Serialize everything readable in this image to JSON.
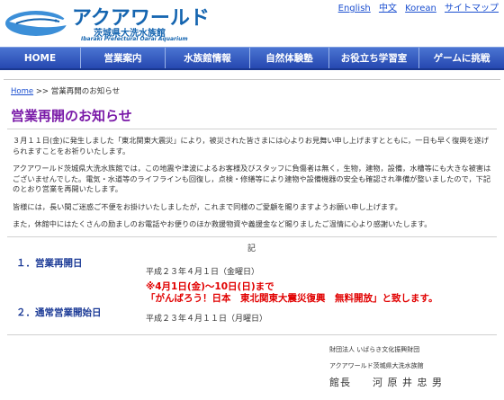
{
  "header": {
    "logo_main": "アクアワールド",
    "logo_sub": "茨城県大洗水族館",
    "logo_en": "Ibaraki Prefectural Oarai Aquarium",
    "links": [
      "English",
      "中文",
      "Korean",
      "サイトマップ"
    ]
  },
  "nav": {
    "items": [
      "HOME",
      "営業案内",
      "水族館情報",
      "自然体験塾",
      "お役立ち学習室",
      "ゲームに挑戦"
    ]
  },
  "breadcrumb": {
    "home": "Home",
    "separator": ">>",
    "current": "営業再開のお知らせ"
  },
  "page": {
    "title": "営業再開のお知らせ",
    "paragraphs": [
      "３月１１日(金)に発生しました「東北関東大震災」により，被災された皆さまには心よりお見舞い申し上げますとともに，一日も早く復興を遂げられますことをお祈りいたします。",
      "アクアワールド茨城県大洗水族館では，この地震や津波によるお客様及びスタッフに負傷者は無く，生物，建物，設備，水槽等にも大きな被害はございませんでした。電気・水道等のライフラインも回復し，点検・修繕等により建物や設備機器の安全も確認され準備が整いましたので，下記のとおり営業を再開いたします。",
      "皆様には，長い間ご迷惑ご不便をお掛けいたしましたが，これまで同様のご愛顧を賜りますようお願い申し上げます。",
      "また，休館中にはたくさんの励ましのお電話やお便りのほか救援物資や義援金など賜りましたご温情に心より感謝いたします。"
    ],
    "ki": "記",
    "items": [
      {
        "label": "１．営業再開日",
        "value": "平成２３年４月１日（金曜日）"
      },
      {
        "label": "２．通常営業開始日",
        "value": "平成２３年４月１１日（月曜日）"
      }
    ],
    "red_note": [
      "※4月1日(金)～10日(日)まで",
      "「がんばろう！日本　東北関東大震災復興　無料開放」と致します。"
    ],
    "signature": {
      "org1": "財団法人 いばらき文化振興財団",
      "org2": "アクアワールド茨城県大洗水族館",
      "name": "館長　　河 原 井 忠 男"
    }
  },
  "colors": {
    "nav_bg": "#2a52b8",
    "title": "#7a1aa8",
    "item_label": "#1b3a96",
    "red_note": "#e10000",
    "link": "#1b4fd0"
  }
}
